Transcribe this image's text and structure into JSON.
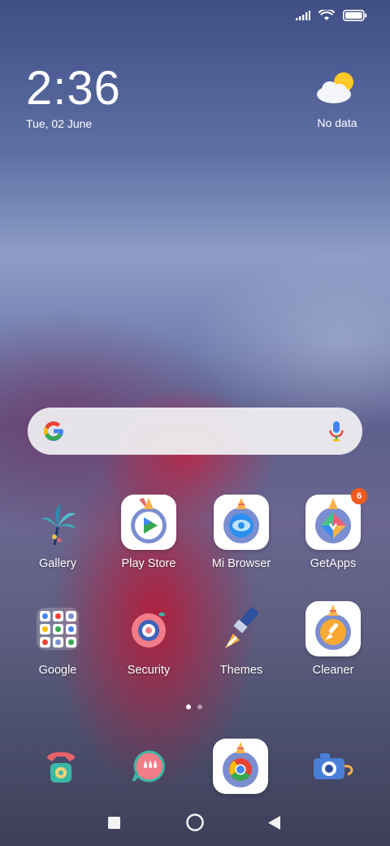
{
  "status_bar": {
    "icons": [
      "signal-icon",
      "wifi-icon",
      "battery-icon"
    ]
  },
  "clock": {
    "time": "2:36",
    "date": "Tue, 02 June"
  },
  "weather": {
    "icon": "partly-cloudy-icon",
    "text": "No data"
  },
  "search_bar": {
    "logo": "google-g-icon",
    "mic": "mic-icon"
  },
  "home": {
    "row1": [
      {
        "label": "Gallery",
        "icon": "gallery-icon"
      },
      {
        "label": "Play Store",
        "icon": "play-store-icon"
      },
      {
        "label": "Mi Browser",
        "icon": "mi-browser-icon"
      },
      {
        "label": "GetApps",
        "icon": "getapps-icon",
        "badge": "6"
      }
    ],
    "row2": [
      {
        "label": "Google",
        "icon": "google-folder-icon"
      },
      {
        "label": "Security",
        "icon": "security-icon"
      },
      {
        "label": "Themes",
        "icon": "themes-icon"
      },
      {
        "label": "Cleaner",
        "icon": "cleaner-icon"
      }
    ]
  },
  "page_indicator": {
    "pages": 2,
    "current": 1
  },
  "dock": [
    {
      "icon": "phone-icon"
    },
    {
      "icon": "messages-icon"
    },
    {
      "icon": "chrome-icon"
    },
    {
      "icon": "camera-icon"
    }
  ],
  "nav_bar": {
    "buttons": [
      "recents-button",
      "home-button",
      "back-button"
    ]
  },
  "colors": {
    "badge": "#f05a1e",
    "search_bg": "#f0f0f2"
  }
}
